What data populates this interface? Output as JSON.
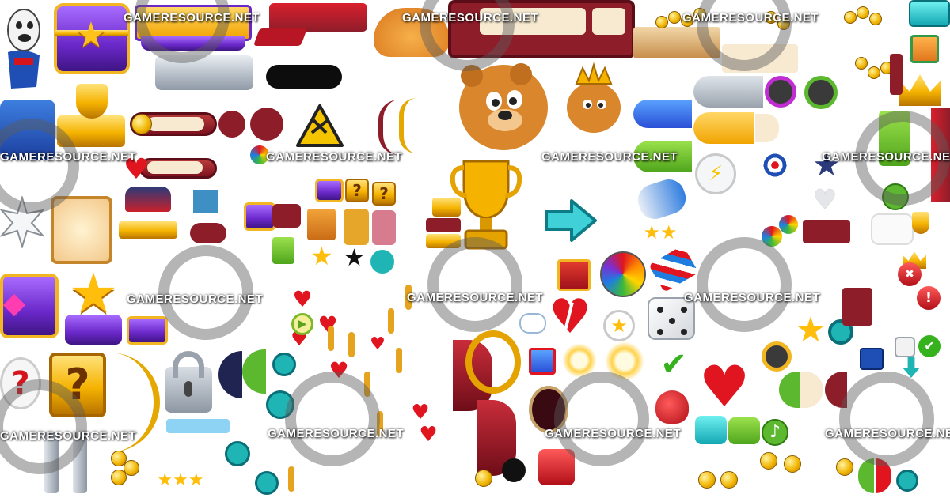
{
  "watermark": {
    "text": "GAMERESOURCE.NET"
  },
  "palette": {
    "gold": "#f5b300",
    "purple": "#6a28c9",
    "maroon": "#8e1d2a",
    "cream": "#f7ead0",
    "teal": "#1fb5b5",
    "green": "#5cb82e",
    "red": "#e0151f",
    "gray": "#9aa3ad"
  },
  "icons": {
    "question": "?",
    "close": "✖",
    "exclamation": "!",
    "check": "✔",
    "music": "♪",
    "star": "★",
    "play": "▶",
    "coin_symbol": "$"
  }
}
